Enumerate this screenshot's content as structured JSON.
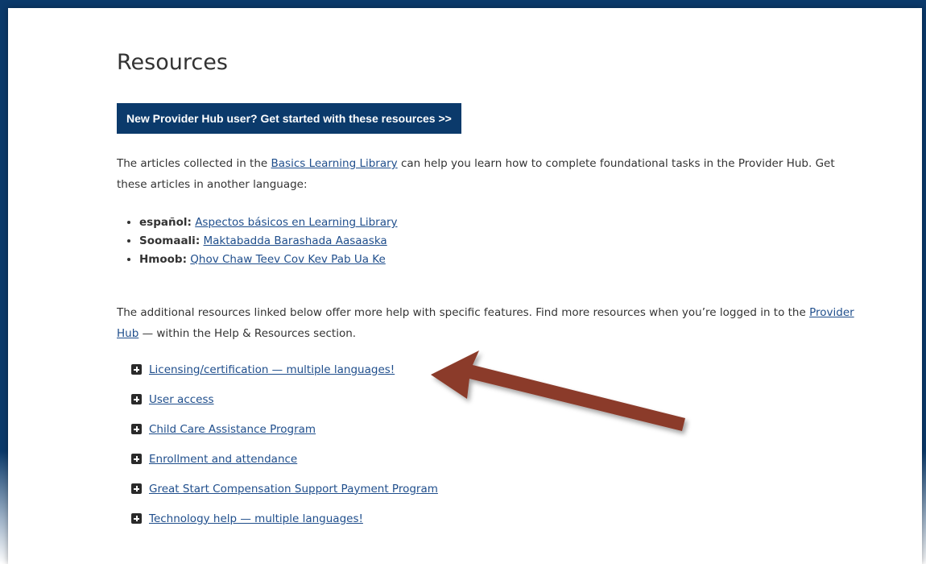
{
  "page": {
    "title": "Resources",
    "cta_label": "New Provider Hub user? Get started with these resources >>",
    "intro": {
      "before_link": "The articles collected in the ",
      "link": "Basics Learning Library",
      "after_link": " can help you learn how to complete foundational tasks in the Provider Hub. Get these articles in another language:"
    },
    "languages": [
      {
        "lang": "español:",
        "link": "Aspectos básicos en Learning Library"
      },
      {
        "lang": "Soomaali:",
        "link": "Maktabadda Barashada Aasaaska"
      },
      {
        "lang": "Hmoob:",
        "link": "Qhov Chaw Teev Cov Kev Pab Ua Ke"
      }
    ],
    "additional": {
      "before_link": "The additional resources linked below offer more help with specific features. Find more resources when you’re logged in to the ",
      "link": "Provider Hub",
      "after_link": " — within the Help & Resources section."
    },
    "accordion": [
      {
        "label": "Licensing/certification — multiple languages!"
      },
      {
        "label": "User access"
      },
      {
        "label": "Child Care Assistance Program"
      },
      {
        "label": "Enrollment and attendance"
      },
      {
        "label": "Great Start Compensation Support Payment Program"
      },
      {
        "label": "Technology help — multiple languages!"
      }
    ]
  },
  "colors": {
    "frame": "#0b3a6b",
    "cta_bg": "#0b3a6b",
    "link": "#1f4e8c",
    "arrow": "#8b3a2a"
  },
  "icons": {
    "accordion_toggle": "plus-square-icon",
    "annotation": "arrow-icon"
  }
}
